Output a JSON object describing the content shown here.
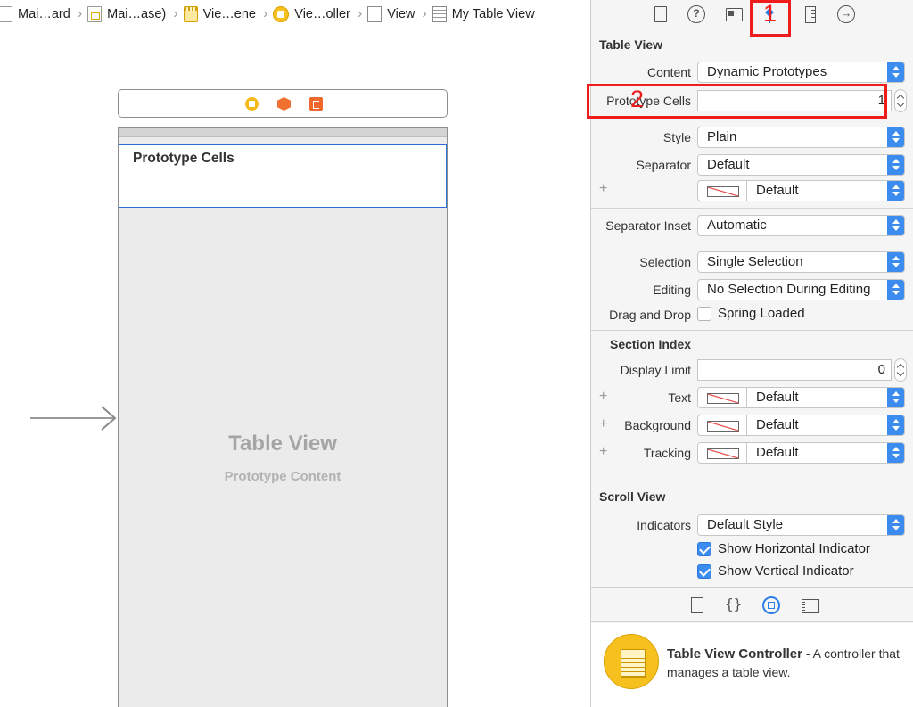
{
  "breadcrumb": {
    "items": [
      {
        "label": "Mai…ard",
        "icon": "storyboard-file-icon"
      },
      {
        "label": "Mai…ase)",
        "icon": "storyboard-base-icon"
      },
      {
        "label": "Vie…ene",
        "icon": "scene-icon"
      },
      {
        "label": "Vie…oller",
        "icon": "view-controller-icon"
      },
      {
        "label": "View",
        "icon": "view-icon"
      },
      {
        "label": "My Table View",
        "icon": "table-view-icon"
      }
    ]
  },
  "canvas": {
    "prototype_cells_label": "Prototype Cells",
    "table_view_title": "Table View",
    "table_view_subtitle": "Prototype Content"
  },
  "inspector": {
    "tabs": [
      "file-inspector-icon",
      "help-icon",
      "identity-inspector-icon",
      "attributes-inspector-icon",
      "size-inspector-icon",
      "connections-inspector-icon"
    ],
    "annotations": {
      "one": "1",
      "two": "2"
    },
    "table_view": {
      "title": "Table View",
      "content_label": "Content",
      "content_value": "Dynamic Prototypes",
      "prototype_cells_label": "Prototype Cells",
      "prototype_cells_value": "1",
      "style_label": "Style",
      "style_value": "Plain",
      "separator_label": "Separator",
      "separator_value": "Default",
      "separator_color_value": "Default",
      "separator_inset_label": "Separator Inset",
      "separator_inset_value": "Automatic",
      "selection_label": "Selection",
      "selection_value": "Single Selection",
      "editing_label": "Editing",
      "editing_value": "No Selection During Editing",
      "drag_drop_label": "Drag and Drop",
      "spring_loaded_label": "Spring Loaded",
      "spring_loaded_checked": false
    },
    "section_index": {
      "title": "Section Index",
      "display_limit_label": "Display Limit",
      "display_limit_value": "0",
      "text_label": "Text",
      "text_value": "Default",
      "background_label": "Background",
      "background_value": "Default",
      "tracking_label": "Tracking",
      "tracking_value": "Default"
    },
    "scroll_view": {
      "title": "Scroll View",
      "indicators_label": "Indicators",
      "indicators_value": "Default Style",
      "show_horizontal_label": "Show Horizontal Indicator",
      "show_horizontal_checked": true,
      "show_vertical_label": "Show Vertical Indicator",
      "show_vertical_checked": true
    },
    "library": {
      "tabs": [
        "file-template-icon",
        "code-snippet-icon",
        "object-library-icon",
        "media-library-icon"
      ],
      "item_title": "Table View Controller",
      "item_description": " - A controller that manages a table view."
    }
  },
  "colors": {
    "accent": "#3c8cf0",
    "annotation_red": "#ee1c1c",
    "selection_blue": "#2b6fd6"
  }
}
